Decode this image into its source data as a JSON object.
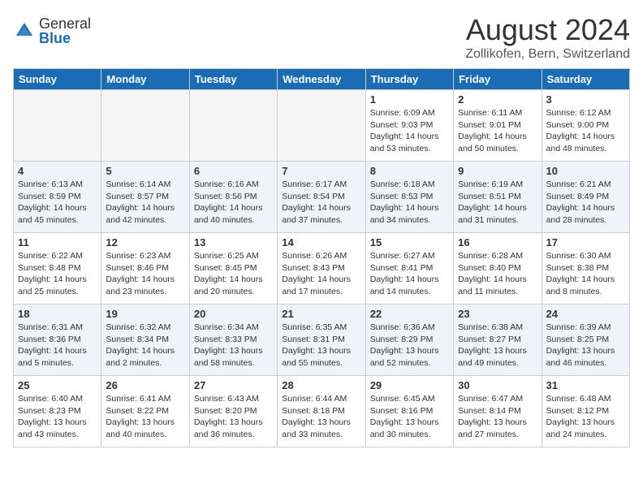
{
  "header": {
    "logo_general": "General",
    "logo_blue": "Blue",
    "month_title": "August 2024",
    "location": "Zollikofen, Bern, Switzerland"
  },
  "days_of_week": [
    "Sunday",
    "Monday",
    "Tuesday",
    "Wednesday",
    "Thursday",
    "Friday",
    "Saturday"
  ],
  "weeks": [
    {
      "days": [
        {
          "date": "",
          "info": ""
        },
        {
          "date": "",
          "info": ""
        },
        {
          "date": "",
          "info": ""
        },
        {
          "date": "",
          "info": ""
        },
        {
          "date": "1",
          "info": "Sunrise: 6:09 AM\nSunset: 9:03 PM\nDaylight: 14 hours\nand 53 minutes."
        },
        {
          "date": "2",
          "info": "Sunrise: 6:11 AM\nSunset: 9:01 PM\nDaylight: 14 hours\nand 50 minutes."
        },
        {
          "date": "3",
          "info": "Sunrise: 6:12 AM\nSunset: 9:00 PM\nDaylight: 14 hours\nand 48 minutes."
        }
      ]
    },
    {
      "days": [
        {
          "date": "4",
          "info": "Sunrise: 6:13 AM\nSunset: 8:59 PM\nDaylight: 14 hours\nand 45 minutes."
        },
        {
          "date": "5",
          "info": "Sunrise: 6:14 AM\nSunset: 8:57 PM\nDaylight: 14 hours\nand 42 minutes."
        },
        {
          "date": "6",
          "info": "Sunrise: 6:16 AM\nSunset: 8:56 PM\nDaylight: 14 hours\nand 40 minutes."
        },
        {
          "date": "7",
          "info": "Sunrise: 6:17 AM\nSunset: 8:54 PM\nDaylight: 14 hours\nand 37 minutes."
        },
        {
          "date": "8",
          "info": "Sunrise: 6:18 AM\nSunset: 8:53 PM\nDaylight: 14 hours\nand 34 minutes."
        },
        {
          "date": "9",
          "info": "Sunrise: 6:19 AM\nSunset: 8:51 PM\nDaylight: 14 hours\nand 31 minutes."
        },
        {
          "date": "10",
          "info": "Sunrise: 6:21 AM\nSunset: 8:49 PM\nDaylight: 14 hours\nand 28 minutes."
        }
      ]
    },
    {
      "days": [
        {
          "date": "11",
          "info": "Sunrise: 6:22 AM\nSunset: 8:48 PM\nDaylight: 14 hours\nand 25 minutes."
        },
        {
          "date": "12",
          "info": "Sunrise: 6:23 AM\nSunset: 8:46 PM\nDaylight: 14 hours\nand 23 minutes."
        },
        {
          "date": "13",
          "info": "Sunrise: 6:25 AM\nSunset: 8:45 PM\nDaylight: 14 hours\nand 20 minutes."
        },
        {
          "date": "14",
          "info": "Sunrise: 6:26 AM\nSunset: 8:43 PM\nDaylight: 14 hours\nand 17 minutes."
        },
        {
          "date": "15",
          "info": "Sunrise: 6:27 AM\nSunset: 8:41 PM\nDaylight: 14 hours\nand 14 minutes."
        },
        {
          "date": "16",
          "info": "Sunrise: 6:28 AM\nSunset: 8:40 PM\nDaylight: 14 hours\nand 11 minutes."
        },
        {
          "date": "17",
          "info": "Sunrise: 6:30 AM\nSunset: 8:38 PM\nDaylight: 14 hours\nand 8 minutes."
        }
      ]
    },
    {
      "days": [
        {
          "date": "18",
          "info": "Sunrise: 6:31 AM\nSunset: 8:36 PM\nDaylight: 14 hours\nand 5 minutes."
        },
        {
          "date": "19",
          "info": "Sunrise: 6:32 AM\nSunset: 8:34 PM\nDaylight: 14 hours\nand 2 minutes."
        },
        {
          "date": "20",
          "info": "Sunrise: 6:34 AM\nSunset: 8:33 PM\nDaylight: 13 hours\nand 58 minutes."
        },
        {
          "date": "21",
          "info": "Sunrise: 6:35 AM\nSunset: 8:31 PM\nDaylight: 13 hours\nand 55 minutes."
        },
        {
          "date": "22",
          "info": "Sunrise: 6:36 AM\nSunset: 8:29 PM\nDaylight: 13 hours\nand 52 minutes."
        },
        {
          "date": "23",
          "info": "Sunrise: 6:38 AM\nSunset: 8:27 PM\nDaylight: 13 hours\nand 49 minutes."
        },
        {
          "date": "24",
          "info": "Sunrise: 6:39 AM\nSunset: 8:25 PM\nDaylight: 13 hours\nand 46 minutes."
        }
      ]
    },
    {
      "days": [
        {
          "date": "25",
          "info": "Sunrise: 6:40 AM\nSunset: 8:23 PM\nDaylight: 13 hours\nand 43 minutes."
        },
        {
          "date": "26",
          "info": "Sunrise: 6:41 AM\nSunset: 8:22 PM\nDaylight: 13 hours\nand 40 minutes."
        },
        {
          "date": "27",
          "info": "Sunrise: 6:43 AM\nSunset: 8:20 PM\nDaylight: 13 hours\nand 36 minutes."
        },
        {
          "date": "28",
          "info": "Sunrise: 6:44 AM\nSunset: 8:18 PM\nDaylight: 13 hours\nand 33 minutes."
        },
        {
          "date": "29",
          "info": "Sunrise: 6:45 AM\nSunset: 8:16 PM\nDaylight: 13 hours\nand 30 minutes."
        },
        {
          "date": "30",
          "info": "Sunrise: 6:47 AM\nSunset: 8:14 PM\nDaylight: 13 hours\nand 27 minutes."
        },
        {
          "date": "31",
          "info": "Sunrise: 6:48 AM\nSunset: 8:12 PM\nDaylight: 13 hours\nand 24 minutes."
        }
      ]
    }
  ]
}
